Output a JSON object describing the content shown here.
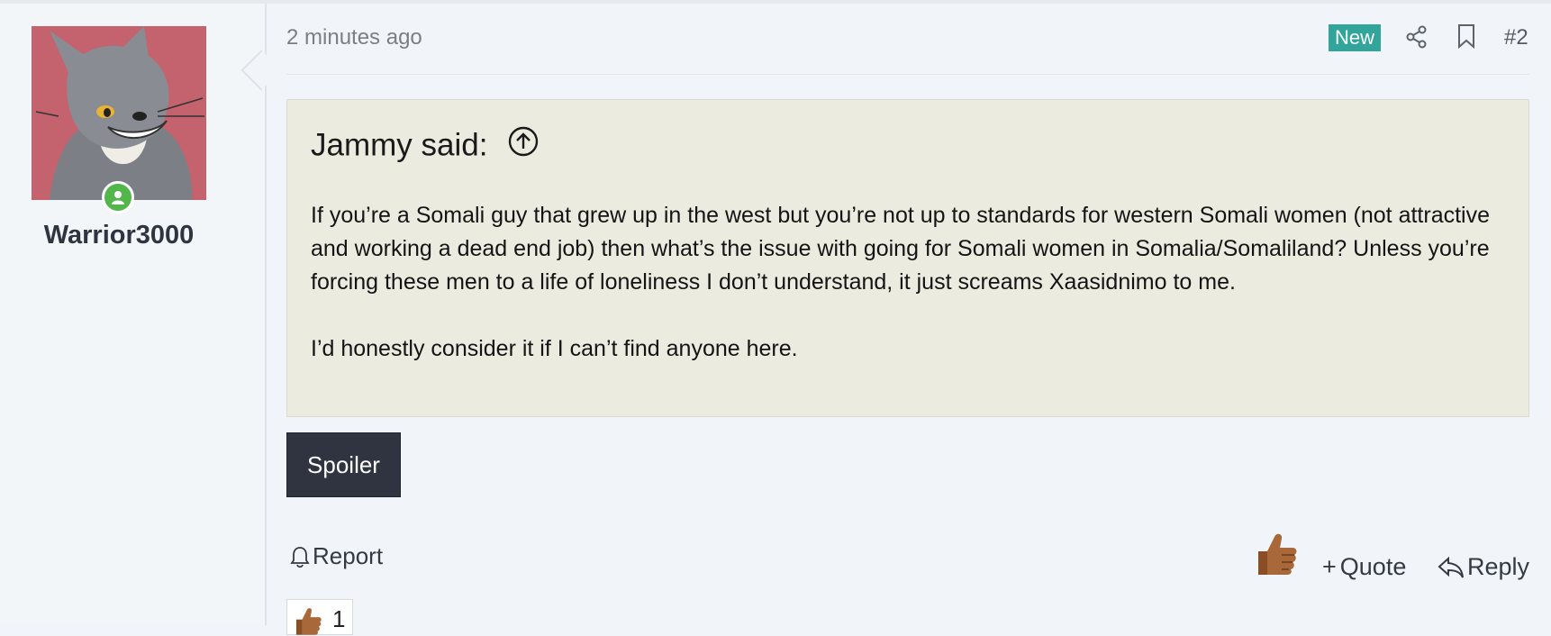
{
  "post": {
    "timestamp": "2 minutes ago",
    "badge": "New",
    "number": "#2"
  },
  "author": {
    "username": "Warrior3000",
    "status": "online",
    "avatar_color": "#c4626e"
  },
  "quote": {
    "title": "Jammy said:",
    "body": [
      "If you’re a Somali guy that grew up in the west but you’re not up to standards for western Somali women (not attractive and working a dead end job) then what’s the issue with going for Somali women in Somalia/Somaliland? Unless you’re forcing these men to a life of loneliness I don’t understand, it just screams Xaasidnimo to me.",
      "I’d honestly consider it if I can’t find anyone here."
    ]
  },
  "spoiler": {
    "label": "Spoiler"
  },
  "actions": {
    "report": "Report",
    "quote": "Quote",
    "quote_plus": "+",
    "reply": "Reply"
  },
  "reactions": {
    "count": "1",
    "icon": "thumbs-up-icon"
  },
  "colors": {
    "accent_badge": "#32a59b",
    "quote_bg": "#ecebdf",
    "spoiler_bg": "#2f3440",
    "online": "#52b64a"
  }
}
